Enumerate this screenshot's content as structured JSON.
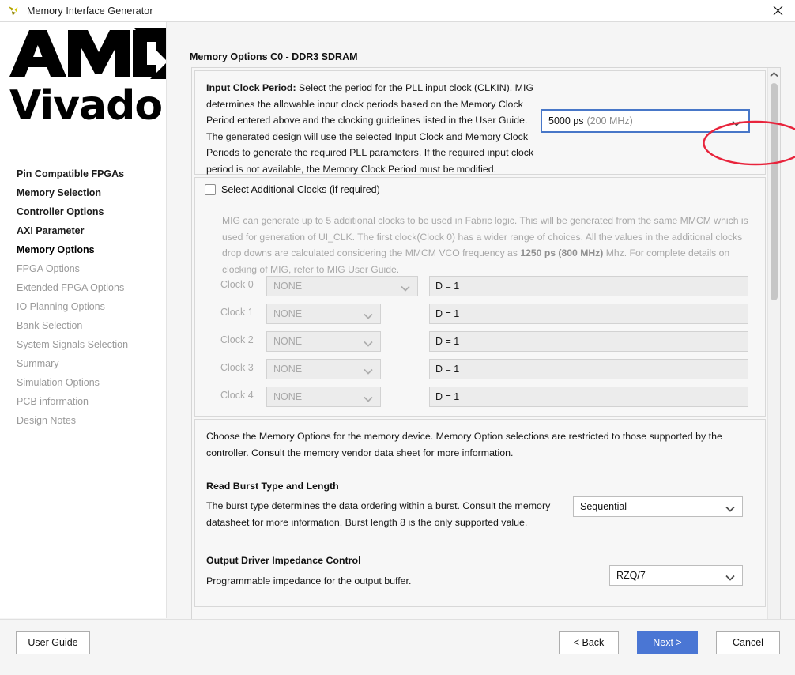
{
  "window": {
    "title": "Memory Interface Generator",
    "app_icon": "vivado-logo-icon",
    "close_icon": "close-icon"
  },
  "sidebar": {
    "logo_top": "AMD",
    "logo_bottom": "Vivado",
    "items": [
      {
        "label": "Pin Compatible FPGAs",
        "state": "done"
      },
      {
        "label": "Memory Selection",
        "state": "done"
      },
      {
        "label": "Controller Options",
        "state": "done"
      },
      {
        "label": "AXI Parameter",
        "state": "done"
      },
      {
        "label": "Memory Options",
        "state": "current"
      },
      {
        "label": "FPGA Options",
        "state": "disabled"
      },
      {
        "label": "Extended FPGA Options",
        "state": "disabled"
      },
      {
        "label": "IO Planning Options",
        "state": "disabled"
      },
      {
        "label": "Bank Selection",
        "state": "disabled"
      },
      {
        "label": "System Signals Selection",
        "state": "disabled"
      },
      {
        "label": "Summary",
        "state": "disabled"
      },
      {
        "label": "Simulation Options",
        "state": "disabled"
      },
      {
        "label": "PCB information",
        "state": "disabled"
      },
      {
        "label": "Design Notes",
        "state": "disabled"
      }
    ]
  },
  "page": {
    "title": "Memory Options C0 - DDR3 SDRAM"
  },
  "input_clock": {
    "label_bold": "Input Clock Period:",
    "description": " Select the period for the PLL input clock (CLKIN). MIG determines the allowable input clock periods based on the Memory Clock Period entered above and the clocking guidelines listed in the User Guide. The generated design will use the selected Input Clock and Memory Clock Periods to generate the required PLL parameters. If the required input clock period is not available, the Memory Clock Period must be modified.",
    "selected_value": "5000 ps",
    "selected_value_suffix": "(200 MHz)",
    "highlight_color": "#e8243c",
    "focus_border_color": "#4877c8"
  },
  "additional_clocks": {
    "checkbox_label": "Select Additional Clocks (if required)",
    "checked": false,
    "description_pre": "MIG can generate up to 5 additional clocks to be used in Fabric logic. This will be generated from the same MMCM which is used for generation of UI_CLK. The first clock(Clock 0) has a wider range of choices. All the values in the additional clocks drop downs are calculated considering the MMCM VCO frequency as ",
    "description_bold": "1250 ps (800 MHz)",
    "description_post": " Mhz. For complete details on clocking of MIG, refer to MIG User Guide.",
    "rows": [
      {
        "label": "Clock 0",
        "value": "NONE",
        "divider": "D = 1"
      },
      {
        "label": "Clock 1",
        "value": "NONE",
        "divider": "D = 1"
      },
      {
        "label": "Clock 2",
        "value": "NONE",
        "divider": "D = 1"
      },
      {
        "label": "Clock 3",
        "value": "NONE",
        "divider": "D = 1"
      },
      {
        "label": "Clock 4",
        "value": "NONE",
        "divider": "D = 1"
      }
    ]
  },
  "memory_options": {
    "intro": "Choose the Memory Options for the memory device. Memory Option selections are restricted to those supported by the controller. Consult the memory vendor data sheet for more information.",
    "read_burst": {
      "heading": "Read Burst Type and Length",
      "description": "The burst type determines the data ordering within a burst. Consult the memory datasheet for more information. Burst length 8 is the only supported value.",
      "value": "Sequential"
    },
    "output_driver": {
      "heading": "Output Driver Impedance Control",
      "description": "Programmable impedance for the output buffer.",
      "value": "RZQ/7"
    }
  },
  "scrollbar": {
    "up_icon": "chevron-up-icon",
    "down_icon": "chevron-down-icon"
  },
  "footer": {
    "user_guide": "User Guide",
    "back": "< Back",
    "next": "Next >",
    "cancel": "Cancel",
    "next_color": "#4a76d4"
  }
}
